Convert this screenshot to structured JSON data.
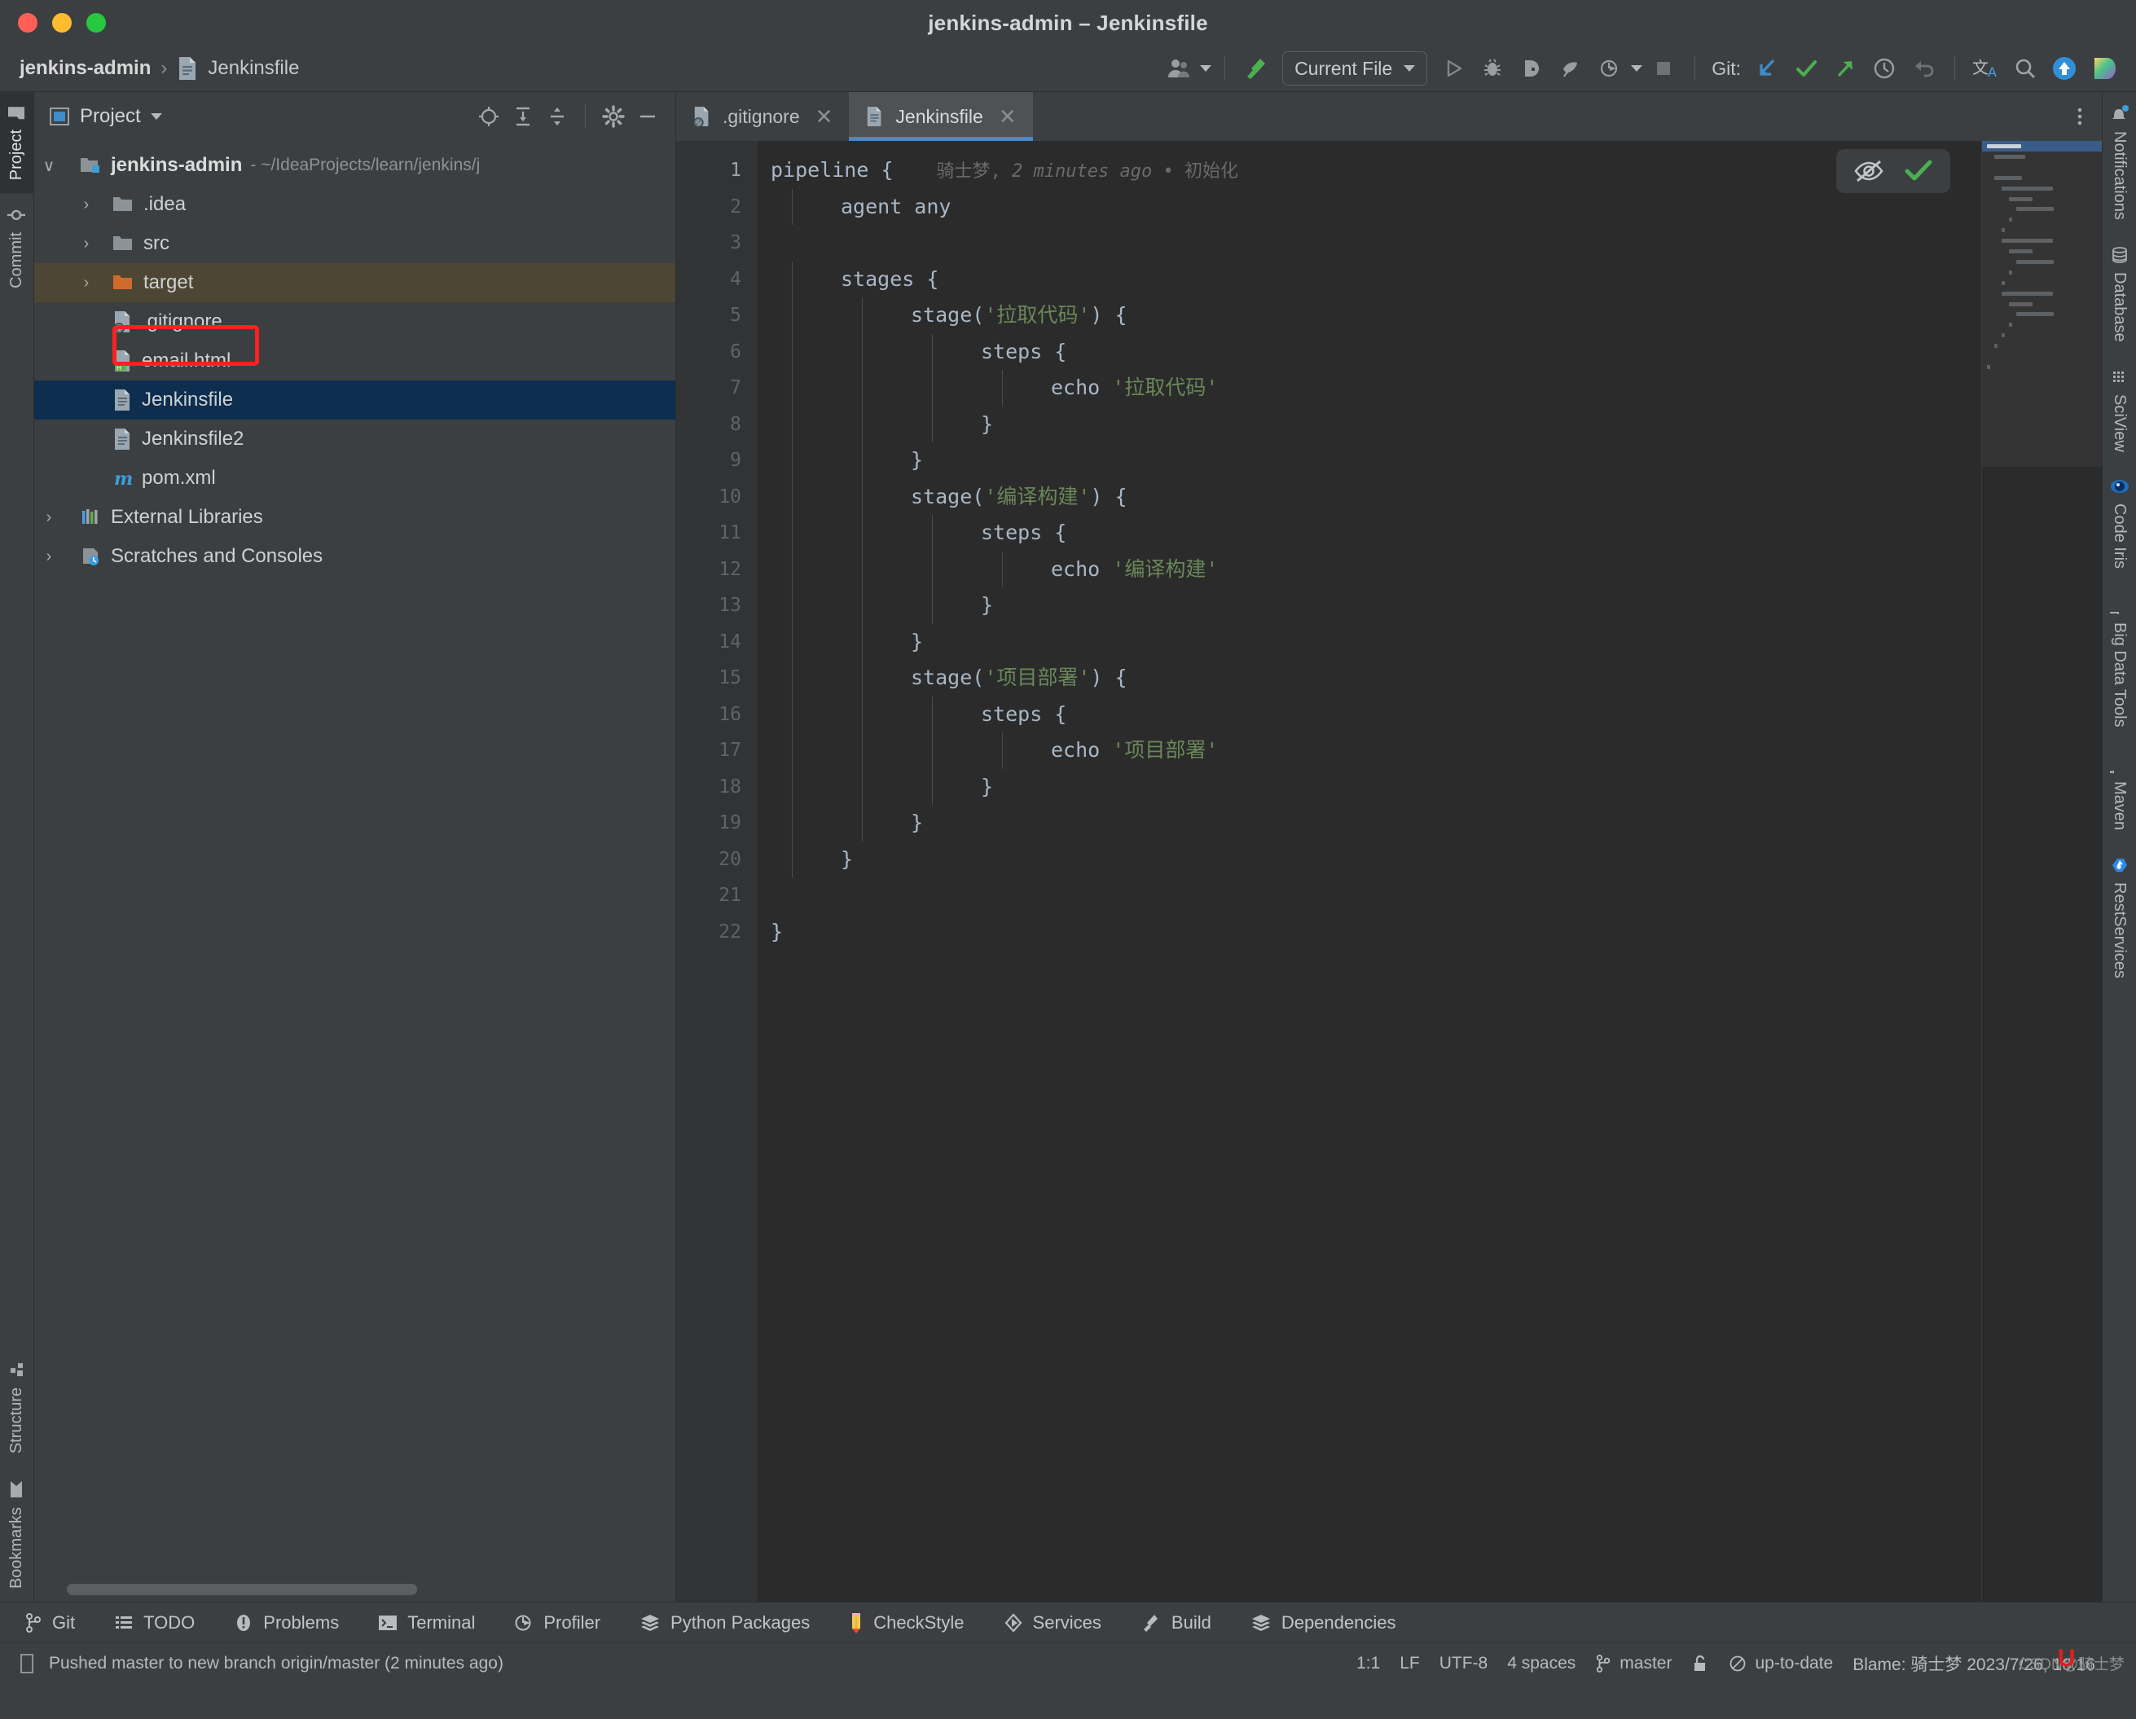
{
  "window": {
    "title": "jenkins-admin – Jenkinsfile",
    "traffic": [
      "close-red",
      "minimize-yellow",
      "maximize-green"
    ]
  },
  "toolbar": {
    "breadcrumb": {
      "project": "jenkins-admin",
      "separator": "›",
      "file": "Jenkinsfile"
    },
    "run_config": "Current File",
    "git_label": "Git:",
    "buttons": [
      "user-account-button",
      "build-hammer-button",
      "run-button",
      "debug-button",
      "run-with-coverage-button",
      "profile-button",
      "run-dropdown-button",
      "stop-button",
      "git-update-button",
      "git-commit-button",
      "git-push-button",
      "git-history-button",
      "git-rollback-button",
      "translate-button",
      "search-everywhere-button",
      "updates-button",
      "ide-feature-button"
    ]
  },
  "left_rail": {
    "top": [
      {
        "label": "Project",
        "icon": "folder-icon",
        "active": true
      },
      {
        "label": "Commit",
        "icon": "commit-icon",
        "active": false
      }
    ],
    "bottom": [
      {
        "label": "Structure",
        "icon": "structure-icon"
      },
      {
        "label": "Bookmarks",
        "icon": "bookmark-icon"
      }
    ]
  },
  "project_panel": {
    "title": "Project",
    "tools": [
      "locate-icon",
      "expand-all-icon",
      "collapse-all-icon",
      "settings-gear-icon",
      "hide-icon"
    ],
    "tree": [
      {
        "label": "jenkins-admin",
        "path": "- ~/IdeaProjects/learn/jenkins/j",
        "icon": "module-folder-icon",
        "level": 0,
        "arrow": "∨",
        "state": "normal"
      },
      {
        "label": ".idea",
        "path": "",
        "icon": "folder-icon",
        "level": 1,
        "arrow": "›",
        "state": "normal"
      },
      {
        "label": "src",
        "path": "",
        "icon": "folder-icon",
        "level": 1,
        "arrow": "›",
        "state": "normal"
      },
      {
        "label": "target",
        "path": "",
        "icon": "folder-orange-icon",
        "level": 1,
        "arrow": "›",
        "state": "target-selected"
      },
      {
        "label": ".gitignore",
        "path": "",
        "icon": "gitignore-file-icon",
        "level": 1,
        "arrow": "",
        "state": "normal"
      },
      {
        "label": "email.html",
        "path": "",
        "icon": "html-file-icon",
        "level": 1,
        "arrow": "",
        "state": "normal"
      },
      {
        "label": "Jenkinsfile",
        "path": "",
        "icon": "text-file-icon",
        "level": 1,
        "arrow": "",
        "state": "selected-highlighted"
      },
      {
        "label": "Jenkinsfile2",
        "path": "",
        "icon": "text-file-icon",
        "level": 1,
        "arrow": "",
        "state": "normal"
      },
      {
        "label": "pom.xml",
        "path": "",
        "icon": "maven-file-icon",
        "level": 1,
        "arrow": "",
        "state": "normal"
      },
      {
        "label": "External Libraries",
        "path": "",
        "icon": "libraries-icon",
        "level": 0,
        "arrow": "›",
        "state": "normal"
      },
      {
        "label": "Scratches and Consoles",
        "path": "",
        "icon": "scratches-icon",
        "level": 0,
        "arrow": "›",
        "state": "normal"
      }
    ]
  },
  "editor": {
    "tabs": [
      {
        "label": ".gitignore",
        "icon": "gitignore-file-icon",
        "active": false
      },
      {
        "label": "Jenkinsfile",
        "icon": "text-file-icon",
        "active": true
      }
    ],
    "blame_annotation": "骑士梦, 2 minutes ago • 初始化",
    "blame_author": "骑士梦,",
    "blame_time": "2 minutes ago",
    "blame_sep": "•",
    "blame_msg": "初始化",
    "line_numbers": [
      "1",
      "2",
      "3",
      "4",
      "5",
      "6",
      "7",
      "8",
      "9",
      "10",
      "11",
      "12",
      "13",
      "14",
      "15",
      "16",
      "17",
      "18",
      "19",
      "20",
      "21",
      "22"
    ],
    "lines": [
      {
        "n": 1,
        "indent": 0,
        "segments": [
          {
            "t": "pipeline",
            "c": "plain"
          },
          {
            "t": " {",
            "c": "plain"
          }
        ]
      },
      {
        "n": 2,
        "indent": 1,
        "segments": [
          {
            "t": "agent any",
            "c": "plain"
          }
        ]
      },
      {
        "n": 3,
        "indent": 0,
        "segments": []
      },
      {
        "n": 4,
        "indent": 1,
        "segments": [
          {
            "t": "stages {",
            "c": "plain"
          }
        ]
      },
      {
        "n": 5,
        "indent": 2,
        "segments": [
          {
            "t": "stage(",
            "c": "plain"
          },
          {
            "t": "'拉取代码'",
            "c": "str"
          },
          {
            "t": ") {",
            "c": "plain"
          }
        ]
      },
      {
        "n": 6,
        "indent": 3,
        "segments": [
          {
            "t": "steps {",
            "c": "plain"
          }
        ]
      },
      {
        "n": 7,
        "indent": 4,
        "segments": [
          {
            "t": "echo ",
            "c": "plain"
          },
          {
            "t": "'拉取代码'",
            "c": "str"
          }
        ]
      },
      {
        "n": 8,
        "indent": 3,
        "segments": [
          {
            "t": "}",
            "c": "plain"
          }
        ]
      },
      {
        "n": 9,
        "indent": 2,
        "segments": [
          {
            "t": "}",
            "c": "plain"
          }
        ]
      },
      {
        "n": 10,
        "indent": 2,
        "segments": [
          {
            "t": "stage(",
            "c": "plain"
          },
          {
            "t": "'编译构建'",
            "c": "str"
          },
          {
            "t": ") {",
            "c": "plain"
          }
        ]
      },
      {
        "n": 11,
        "indent": 3,
        "segments": [
          {
            "t": "steps {",
            "c": "plain"
          }
        ]
      },
      {
        "n": 12,
        "indent": 4,
        "segments": [
          {
            "t": "echo ",
            "c": "plain"
          },
          {
            "t": "'编译构建'",
            "c": "str"
          }
        ]
      },
      {
        "n": 13,
        "indent": 3,
        "segments": [
          {
            "t": "}",
            "c": "plain"
          }
        ]
      },
      {
        "n": 14,
        "indent": 2,
        "segments": [
          {
            "t": "}",
            "c": "plain"
          }
        ]
      },
      {
        "n": 15,
        "indent": 2,
        "segments": [
          {
            "t": "stage(",
            "c": "plain"
          },
          {
            "t": "'项目部署'",
            "c": "str"
          },
          {
            "t": ") {",
            "c": "plain"
          }
        ]
      },
      {
        "n": 16,
        "indent": 3,
        "segments": [
          {
            "t": "steps {",
            "c": "plain"
          }
        ]
      },
      {
        "n": 17,
        "indent": 4,
        "segments": [
          {
            "t": "echo ",
            "c": "plain"
          },
          {
            "t": "'项目部署'",
            "c": "str"
          }
        ]
      },
      {
        "n": 18,
        "indent": 3,
        "segments": [
          {
            "t": "}",
            "c": "plain"
          }
        ]
      },
      {
        "n": 19,
        "indent": 2,
        "segments": [
          {
            "t": "}",
            "c": "plain"
          }
        ]
      },
      {
        "n": 20,
        "indent": 1,
        "segments": [
          {
            "t": "}",
            "c": "plain"
          }
        ]
      },
      {
        "n": 21,
        "indent": 0,
        "segments": []
      },
      {
        "n": 22,
        "indent": 0,
        "segments": [
          {
            "t": "}",
            "c": "plain"
          }
        ]
      }
    ],
    "inspection": {
      "hide_icon": "eye-crossed-icon",
      "status_icon": "checkmark-green-icon"
    }
  },
  "right_rail": [
    {
      "label": "Notifications",
      "icon": "bell-icon"
    },
    {
      "label": "Database",
      "icon": "database-icon"
    },
    {
      "label": "SciView",
      "icon": "sciview-icon"
    },
    {
      "label": "Code Iris",
      "icon": "code-iris-icon"
    },
    {
      "label": "Big Data Tools",
      "icon": "big-data-tools-icon"
    },
    {
      "label": "Maven",
      "icon": "maven-icon"
    },
    {
      "label": "RestServices",
      "icon": "rest-services-icon"
    }
  ],
  "bottom_bar": [
    {
      "label": "Git",
      "icon": "git-branch-icon"
    },
    {
      "label": "TODO",
      "icon": "todo-list-icon"
    },
    {
      "label": "Problems",
      "icon": "problems-icon"
    },
    {
      "label": "Terminal",
      "icon": "terminal-icon"
    },
    {
      "label": "Profiler",
      "icon": "profiler-icon"
    },
    {
      "label": "Python Packages",
      "icon": "python-packages-icon"
    },
    {
      "label": "CheckStyle",
      "icon": "checkstyle-pencil-icon"
    },
    {
      "label": "Services",
      "icon": "services-icon"
    },
    {
      "label": "Build",
      "icon": "build-hammer-icon"
    },
    {
      "label": "Dependencies",
      "icon": "dependencies-icon"
    }
  ],
  "status_bar": {
    "message": "Pushed master to new branch origin/master (2 minutes ago)",
    "caret": "1:1",
    "line_separator": "LF",
    "encoding": "UTF-8",
    "indent": "4 spaces",
    "branch": "master",
    "lock_icon": "unlocked-icon",
    "inspection_status": "up-to-date",
    "blame": "Blame: 骑士梦 2023/7/26, 16:16",
    "watermark": "CSDN@骑士梦"
  }
}
